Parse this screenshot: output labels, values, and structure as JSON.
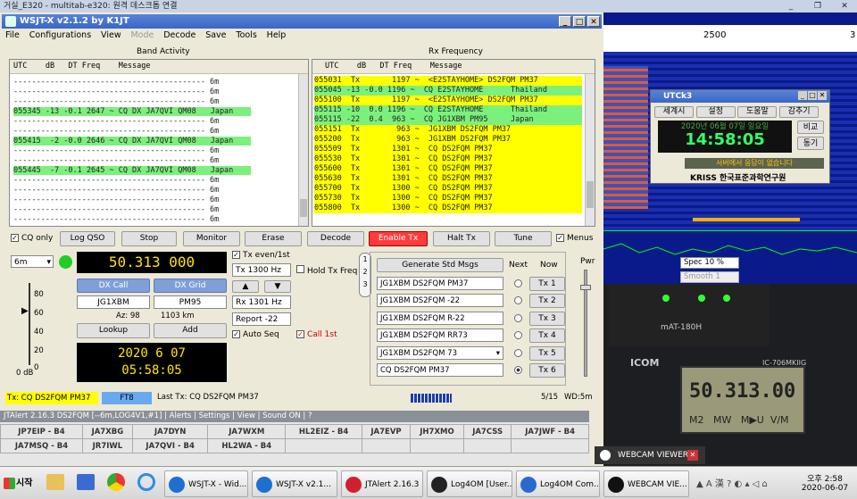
{
  "remote_bar": {
    "title": "거실_E320 - multitab-e320: 원격 데스크톱 연결"
  },
  "wsjt": {
    "title": "WSJT-X   v2.1.2   by K1JT",
    "menu": [
      "File",
      "Configurations",
      "View",
      "Mode",
      "Decode",
      "Save",
      "Tools",
      "Help"
    ],
    "band_activity_label": "Band Activity",
    "rx_freq_label": "Rx Frequency",
    "col_header": "UTC    dB   DT Freq    Message",
    "band_lines": [
      {
        "t": "------------------------------------------ 6m",
        "c": ""
      },
      {
        "t": "------------------------------------------ 6m",
        "c": ""
      },
      {
        "t": "------------------------------------------ 6m",
        "c": ""
      },
      {
        "t": "055345 -13 -0.1 2647 ~ CQ DX JA7QVI QM08",
        "c": "g",
        "x": "Japan"
      },
      {
        "t": "------------------------------------------ 6m",
        "c": ""
      },
      {
        "t": "------------------------------------------ 6m",
        "c": ""
      },
      {
        "t": "055415  -2 -0.0 2646 ~ CQ DX JA7QVI QM08",
        "c": "g",
        "x": "Japan"
      },
      {
        "t": "------------------------------------------ 6m",
        "c": ""
      },
      {
        "t": "------------------------------------------ 6m",
        "c": ""
      },
      {
        "t": "055445  -7 -0.1 2645 ~ CQ DX JA7QVI QM08",
        "c": "g",
        "x": "Japan"
      },
      {
        "t": "------------------------------------------ 6m",
        "c": ""
      },
      {
        "t": "------------------------------------------ 6m",
        "c": ""
      },
      {
        "t": "------------------------------------------ 6m",
        "c": ""
      },
      {
        "t": "------------------------------------------ 6m",
        "c": ""
      },
      {
        "t": "------------------------------------------ 6m",
        "c": ""
      }
    ],
    "rx_lines": [
      {
        "t": "055031  Tx       1197 ~  <E2STAYHOME> DS2FQM PM37",
        "c": "y"
      },
      {
        "t": "055045 -13 -0.0 1196 ~  CQ E2STAYHOME      Thailand",
        "c": "g"
      },
      {
        "t": "055100  Tx       1197 ~  <E2STAYHOME> DS2FQM PM37",
        "c": "y"
      },
      {
        "t": "055115 -10  0.0 1196 ~  CQ E2STAYHOME      Thailand",
        "c": "g"
      },
      {
        "t": "055115 -22  0.4  963 ~  CQ JG1XBM PM95     Japan",
        "c": "g"
      },
      {
        "t": "055151  Tx        963 ~  JG1XBM DS2FQM PM37",
        "c": "y"
      },
      {
        "t": "055200  Tx        963 ~  JG1XBM DS2FQM PM37",
        "c": "y"
      },
      {
        "t": "055509  Tx       1301 ~  CQ DS2FQM PM37",
        "c": "y"
      },
      {
        "t": "055530  Tx       1301 ~  CQ DS2FQM PM37",
        "c": "y"
      },
      {
        "t": "055600  Tx       1301 ~  CQ DS2FQM PM37",
        "c": "y"
      },
      {
        "t": "055630  Tx       1301 ~  CQ DS2FQM PM37",
        "c": "y"
      },
      {
        "t": "055700  Tx       1300 ~  CQ DS2FQM PM37",
        "c": "y"
      },
      {
        "t": "055730  Tx       1300 ~  CQ DS2FQM PM37",
        "c": "y"
      },
      {
        "t": "055800  Tx       1300 ~  CQ DS2FQM PM37",
        "c": "y"
      }
    ],
    "buttons": {
      "cq_only": "CQ only",
      "log_qso": "Log QSO",
      "stop": "Stop",
      "monitor": "Monitor",
      "erase": "Erase",
      "decode": "Decode",
      "enable_tx": "Enable Tx",
      "halt_tx": "Halt Tx",
      "tune": "Tune",
      "menus": "Menus"
    },
    "band": "6m",
    "frequency": "50.313 000",
    "dx_call_label": "DX Call",
    "dx_grid_label": "DX Grid",
    "dx_call": "JG1XBM",
    "dx_grid": "PM95",
    "az": "Az: 98",
    "dist": "1103 km",
    "lookup": "Lookup",
    "add": "Add",
    "date": "2020 6 07",
    "time": "05:58:05",
    "meter_ticks": [
      "80",
      "60",
      "40",
      "20",
      "0"
    ],
    "meter_label": "0 dB",
    "tx_even": "Tx even/1st",
    "tx_hz": "Tx  1300  Hz",
    "hold_tx": "Hold Tx Freq",
    "rx_hz": "Rx  1301  Hz",
    "report": "Report -22",
    "auto_seq": "Auto Seq",
    "call_1st": "Call 1st",
    "tabs": [
      "1",
      "2",
      "3"
    ],
    "gen_msgs": "Generate Std Msgs",
    "next": "Next",
    "now": "Now",
    "pwr": "Pwr",
    "msgs": [
      "JG1XBM DS2FQM PM37",
      "JG1XBM DS2FQM -22",
      "JG1XBM DS2FQM R-22",
      "JG1XBM DS2FQM RR73",
      "JG1XBM DS2FQM 73",
      "CQ DS2FQM PM37"
    ],
    "tx_btns": [
      "Tx 1",
      "Tx 2",
      "Tx 3",
      "Tx 4",
      "Tx 5",
      "Tx 6"
    ],
    "status": {
      "tx": "Tx: CQ DS2FQM PM37",
      "mode": "FT8",
      "last_tx": "Last Tx: CQ DS2FQM PM37",
      "count": "5/15",
      "wd": "WD:5m"
    }
  },
  "jtalert": {
    "title": "JTAlert 2.16.3 DS2FQM [--6m,LOG4V1,#1]   | Alerts | Settings | View | Sound ON | ?",
    "row1": [
      "JP7EIP - B4",
      "JA7XBG",
      "JA7DYN",
      "JA7WXM",
      "HL2EIZ - B4",
      "JA7EVP",
      "JH7XMO",
      "JA7CSS",
      "JA7JWF - B4"
    ],
    "row2": [
      "JA7MSQ - B4",
      "JR7IWL",
      "JA7QVI - B4",
      "HL2WA - B4",
      "",
      "",
      "",
      "",
      ""
    ]
  },
  "waterfall": {
    "tick": "2500",
    "tick2": "3"
  },
  "utck": {
    "title": "UTCk3",
    "menu": [
      "세계시",
      "설정",
      "도움말",
      "감추기"
    ],
    "date": "2020년 06월 07일 일요일",
    "time": "14:58:05",
    "compare": "비교",
    "sync": "동기",
    "msg": "서버에서 응답이 없습니다",
    "logo": "KRISS 한국표준과학연구원"
  },
  "spec": {
    "spec": "Spec 10 %",
    "smooth": "Smooth 1"
  },
  "webcam": {
    "label": "WEBCAM VIEWER",
    "radio_freq": "50.313.00",
    "radio_model": "IC-706MKIIG",
    "mat": "mAT-180H",
    "m2": "M2   MW   M▶U  V/M",
    "icom": "ICOM"
  },
  "taskbar": {
    "start": "시작",
    "tasks": [
      "WSJT-X - Wid...",
      "WSJT-X   v2.1...",
      "JTAlert 2.16.3 ...",
      "Log4OM [User...",
      "Log4OM Com...",
      "WEBCAM VIE..."
    ],
    "time": "오후 2:58",
    "date": "2020-06-07"
  }
}
